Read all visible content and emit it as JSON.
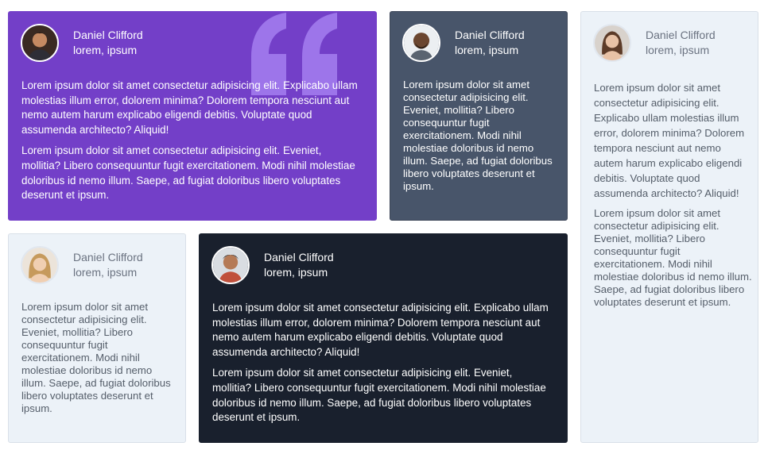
{
  "testimonials": [
    {
      "name": "Daniel Clifford",
      "role": "lorem, ipsum",
      "paragraph1": "Lorem ipsum dolor sit amet consectetur adipisicing elit. Explicabo ullam molestias illum error, dolorem minima? Dolorem tempora nesciunt aut nemo autem harum explicabo eligendi debitis. Voluptate quod assumenda architecto? Aliquid!",
      "paragraph2": "Lorem ipsum dolor sit amet consectetur adipisicing elit. Eveniet, mollitia? Libero consequuntur fugit exercitationem. Modi nihil molestiae doloribus id nemo illum. Saepe, ad fugiat doloribus libero voluptates deserunt et ipsum."
    },
    {
      "name": "Daniel Clifford",
      "role": "lorem, ipsum",
      "paragraph1": "Lorem ipsum dolor sit amet consectetur adipisicing elit. Eveniet, mollitia? Libero consequuntur fugit exercitationem. Modi nihil molestiae doloribus id nemo illum. Saepe, ad fugiat doloribus libero voluptates deserunt et ipsum."
    },
    {
      "name": "Daniel Clifford",
      "role": "lorem, ipsum",
      "paragraph1": "Lorem ipsum dolor sit amet consectetur adipisicing elit. Explicabo ullam molestias illum error, dolorem minima? Dolorem tempora nesciunt aut nemo autem harum explicabo eligendi debitis. Voluptate quod assumenda architecto? Aliquid!",
      "paragraph2": "Lorem ipsum dolor sit amet consectetur adipisicing elit. Eveniet, mollitia? Libero consequuntur fugit exercitationem. Modi nihil molestiae doloribus id nemo illum. Saepe, ad fugiat doloribus libero voluptates deserunt et ipsum."
    },
    {
      "name": "Daniel Clifford",
      "role": "lorem, ipsum",
      "paragraph1": "Lorem ipsum dolor sit amet consectetur adipisicing elit. Eveniet, mollitia? Libero consequuntur fugit exercitationem. Modi nihil molestiae doloribus id nemo illum. Saepe, ad fugiat doloribus libero voluptates deserunt et ipsum."
    },
    {
      "name": "Daniel Clifford",
      "role": "lorem, ipsum",
      "paragraph1": "Lorem ipsum dolor sit amet consectetur adipisicing elit. Explicabo ullam molestias illum error, dolorem minima? Dolorem tempora nesciunt aut nemo autem harum explicabo eligendi debitis. Voluptate quod assumenda architecto? Aliquid!",
      "paragraph2": "Lorem ipsum dolor sit amet consectetur adipisicing elit. Eveniet, mollitia? Libero consequuntur fugit exercitationem. Modi nihil molestiae doloribus id nemo illum. Saepe, ad fugiat doloribus libero voluptates deserunt et ipsum."
    }
  ],
  "colors": {
    "purple": "#733fc8",
    "slate": "#48556a",
    "light": "#ecf2f8",
    "dark": "#19202d"
  },
  "icons": {
    "quote": "quote-mark-icon"
  }
}
